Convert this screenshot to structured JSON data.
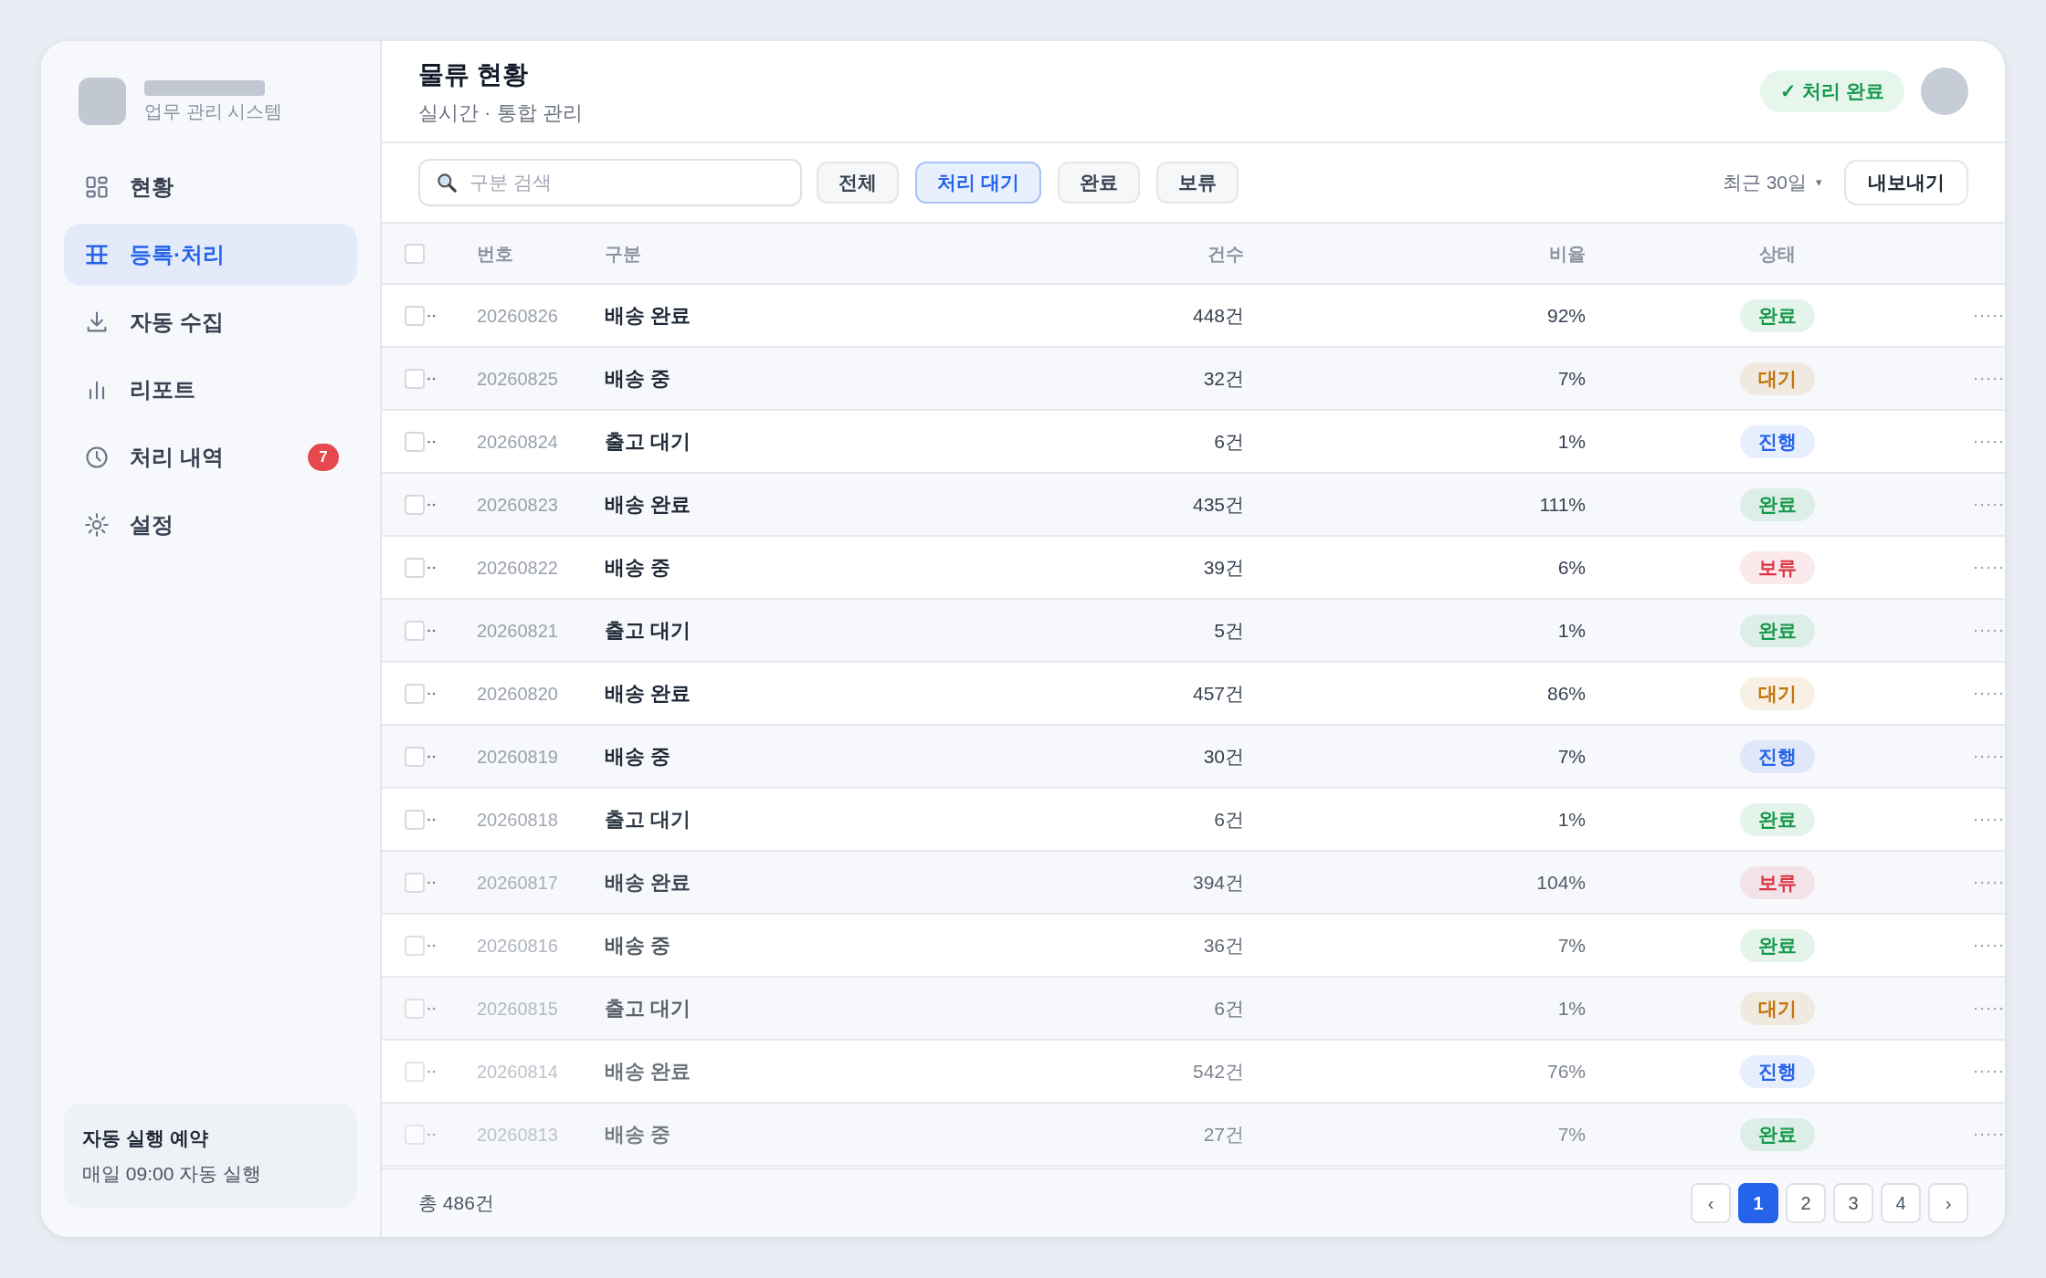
{
  "sidebar": {
    "subtitle": "업무 관리 시스템",
    "items": [
      {
        "label": "현황",
        "selected": false
      },
      {
        "label": "등록·처리",
        "selected": true
      },
      {
        "label": "자동 수집",
        "selected": false
      },
      {
        "label": "리포트",
        "selected": false
      },
      {
        "label": "처리 내역",
        "selected": false,
        "badge": "7"
      },
      {
        "label": "설정",
        "selected": false
      }
    ],
    "schedule": {
      "title": "자동 실행 예약",
      "text": "매일 09:00 자동 실행"
    }
  },
  "header": {
    "title": "물류 현황",
    "subtitle": "실시간 · 통합 관리",
    "status_badge": "✓ 처리 완료"
  },
  "toolbar": {
    "search": {
      "placeholder": "구분 검색"
    },
    "filters": [
      {
        "label": "전체",
        "selected": false
      },
      {
        "label": "처리 대기",
        "selected": true
      },
      {
        "label": "완료",
        "selected": false
      },
      {
        "label": "보류",
        "selected": false
      }
    ],
    "period": {
      "label": "최근 30일",
      "caret": "▾"
    },
    "export": "내보내기"
  },
  "table": {
    "header_checked": false,
    "columns": [
      "번호",
      "구분",
      "건수",
      "비율",
      "상태"
    ],
    "rows": [
      {
        "checked": false,
        "number": "20260826",
        "category": "배송 완료",
        "count": "448건",
        "ratio": "92%",
        "status": {
          "label": "완료",
          "color": "#15994a"
        }
      },
      {
        "checked": false,
        "number": "20260825",
        "category": "배송 중",
        "count": "32건",
        "ratio": "7%",
        "status": {
          "label": "대기",
          "color": "#c27408"
        }
      },
      {
        "checked": false,
        "number": "20260824",
        "category": "출고 대기",
        "count": "6건",
        "ratio": "1%",
        "status": {
          "label": "진행",
          "color": "#2563eb"
        }
      },
      {
        "checked": false,
        "number": "20260823",
        "category": "배송 완료",
        "count": "435건",
        "ratio": "111%",
        "status": {
          "label": "완료",
          "color": "#15994a"
        }
      },
      {
        "checked": false,
        "number": "20260822",
        "category": "배송 중",
        "count": "39건",
        "ratio": "6%",
        "status": {
          "label": "보류",
          "color": "#dc3545"
        }
      },
      {
        "checked": false,
        "number": "20260821",
        "category": "출고 대기",
        "count": "5건",
        "ratio": "1%",
        "status": {
          "label": "완료",
          "color": "#15994a"
        }
      },
      {
        "checked": false,
        "number": "20260820",
        "category": "배송 완료",
        "count": "457건",
        "ratio": "86%",
        "status": {
          "label": "대기",
          "color": "#c27408"
        }
      },
      {
        "checked": false,
        "number": "20260819",
        "category": "배송 중",
        "count": "30건",
        "ratio": "7%",
        "status": {
          "label": "진행",
          "color": "#2563eb"
        }
      },
      {
        "checked": false,
        "number": "20260818",
        "category": "출고 대기",
        "count": "6건",
        "ratio": "1%",
        "status": {
          "label": "완료",
          "color": "#15994a"
        }
      },
      {
        "checked": false,
        "number": "20260817",
        "category": "배송 완료",
        "count": "394건",
        "ratio": "104%",
        "status": {
          "label": "보류",
          "color": "#dc3545"
        }
      },
      {
        "checked": false,
        "number": "20260816",
        "category": "배송 중",
        "count": "36건",
        "ratio": "7%",
        "status": {
          "label": "완료",
          "color": "#15994a"
        }
      },
      {
        "checked": false,
        "number": "20260815",
        "category": "출고 대기",
        "count": "6건",
        "ratio": "1%",
        "status": {
          "label": "대기",
          "color": "#c27408"
        }
      },
      {
        "checked": false,
        "number": "20260814",
        "category": "배송 완료",
        "count": "542건",
        "ratio": "76%",
        "status": {
          "label": "진행",
          "color": "#2563eb"
        }
      },
      {
        "checked": false,
        "number": "20260813",
        "category": "배송 중",
        "count": "27건",
        "ratio": "7%",
        "status": {
          "label": "완료",
          "color": "#15994a"
        }
      }
    ]
  },
  "footer": {
    "total": "총 486건",
    "pages": [
      {
        "label": "‹",
        "selected": false
      },
      {
        "label": "1",
        "selected": true
      },
      {
        "label": "2",
        "selected": false
      },
      {
        "label": "3",
        "selected": false
      },
      {
        "label": "4",
        "selected": false
      },
      {
        "label": "›",
        "selected": false
      }
    ]
  }
}
